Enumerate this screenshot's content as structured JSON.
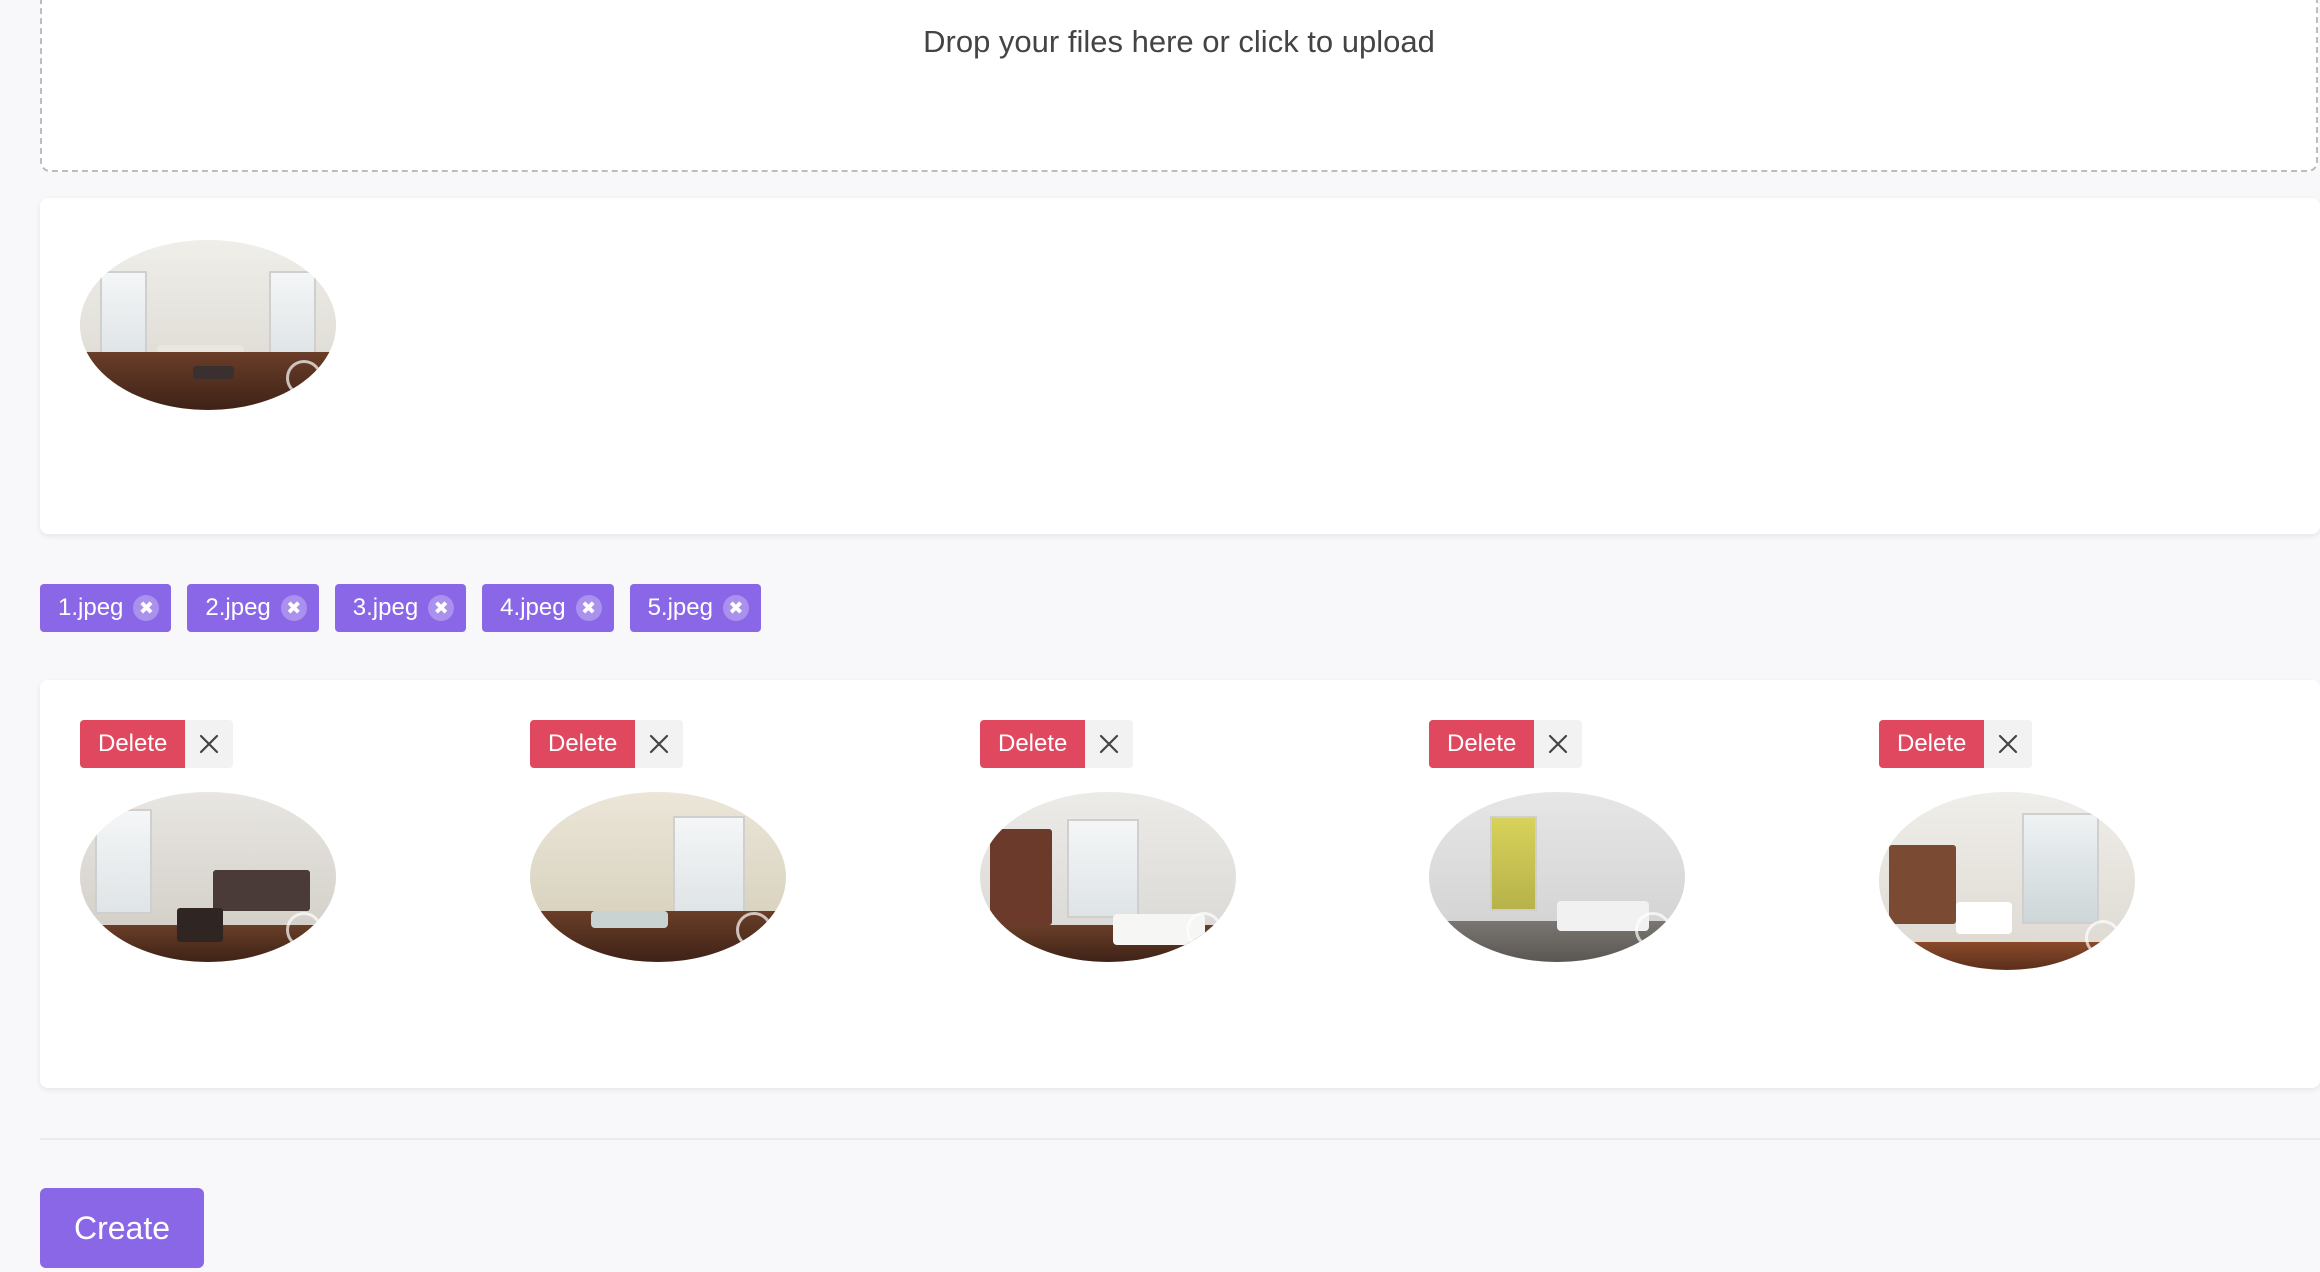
{
  "dropzone": {
    "text": "Drop your files here or click to upload"
  },
  "preview": {
    "image_icon": "room-photo"
  },
  "tags": [
    {
      "label": "1.jpeg"
    },
    {
      "label": "2.jpeg"
    },
    {
      "label": "3.jpeg"
    },
    {
      "label": "4.jpeg"
    },
    {
      "label": "5.jpeg"
    }
  ],
  "tag_remove_glyph": "✖",
  "gallery": {
    "delete_label": "Delete",
    "items": [
      {
        "name": "1.jpeg"
      },
      {
        "name": "2.jpeg"
      },
      {
        "name": "3.jpeg"
      },
      {
        "name": "4.jpeg"
      },
      {
        "name": "5.jpeg"
      }
    ]
  },
  "actions": {
    "create_label": "Create"
  },
  "colors": {
    "accent": "#8a67e6",
    "danger": "#e0485f"
  }
}
